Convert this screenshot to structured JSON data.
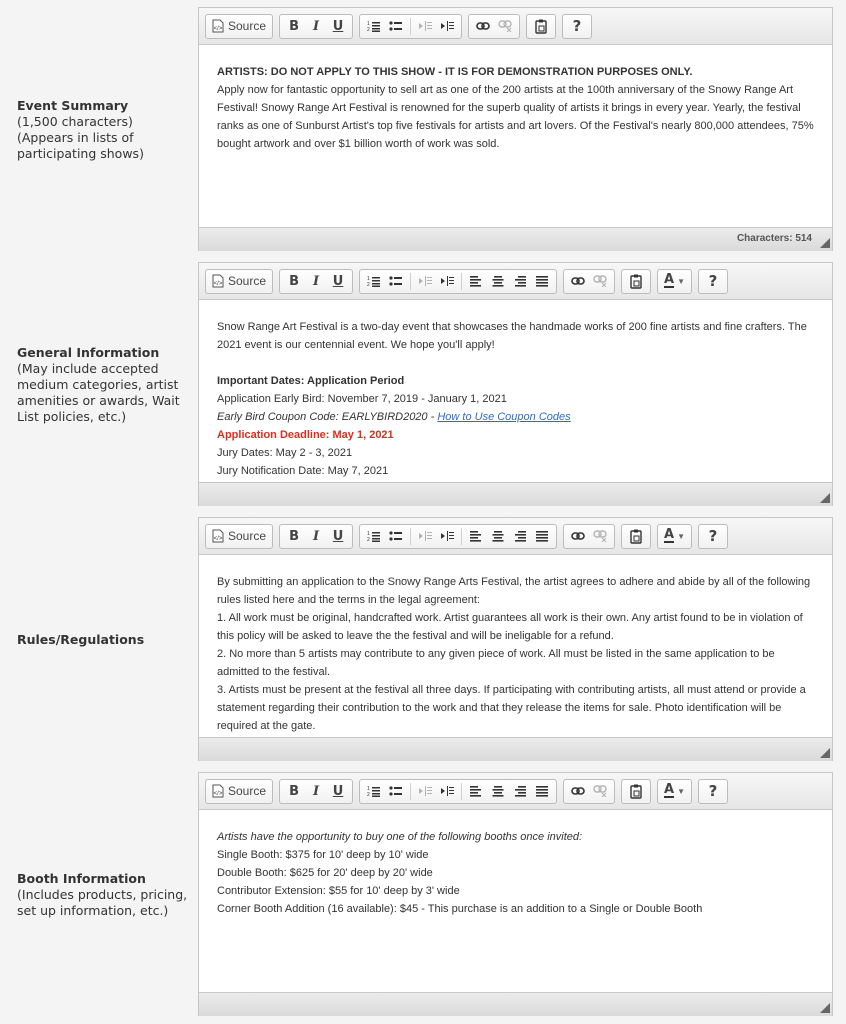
{
  "toolbar": {
    "source_label": "Source",
    "bold_label": "B",
    "italic_label": "I",
    "underline_label": "U",
    "help_label": "?",
    "text_color_label": "A"
  },
  "sections": [
    {
      "label_title": "Event Summary",
      "label_lines": [
        "(1,500 characters)",
        "(Appears in lists of participating shows)"
      ],
      "char_count": "Characters: 514",
      "content": [
        {
          "text": "ARTISTS: DO NOT APPLY TO THIS SHOW - IT IS FOR DEMONSTRATION PURPOSES ONLY.",
          "style": "bold"
        },
        {
          "text": "Apply now for fantastic opportunity to sell art as one of the 200 artists at the 100th anniversary of the Snowy Range Art Festival! Snowy Range Art Festival is renowned for the superb quality of artists it brings in every year. Yearly, the festival ranks as one of Sunburst Artist's top five festivals for artists and art lovers. Of the Festival's nearly 800,000 attendees, 75% bought artwork and over $1 billion worth of work was sold.",
          "style": "normal"
        }
      ]
    },
    {
      "label_title": "General Information",
      "label_lines": [
        "(May include accepted medium categories, artist amenities or awards, Wait List policies, etc.)"
      ],
      "content": [
        {
          "text": "Snow Range Art Festival is a two-day event that showcases the handmade works of 200 fine artists and fine crafters. The 2021 event is our centennial event. We hope you'll apply!",
          "style": "normal"
        },
        {
          "text": "",
          "style": "blank"
        },
        {
          "text": "Important Dates: Application Period",
          "style": "bold"
        },
        {
          "text": "Application Early Bird: November 7, 2019 - January 1, 2021",
          "style": "normal"
        },
        {
          "text": "Early Bird Coupon Code: EARLYBIRD2020 - ",
          "style": "italic",
          "link": "How to Use Coupon Codes"
        },
        {
          "text": "Application Deadline: May 1, 2021",
          "style": "red"
        },
        {
          "text": "Jury Dates: May 2 - 3, 2021",
          "style": "normal"
        },
        {
          "text": "Jury Notification Date: May 7, 2021",
          "style": "normal"
        }
      ]
    },
    {
      "label_title": "Rules/Regulations",
      "label_lines": [],
      "content": [
        {
          "text": "By submitting an application to the Snowy Range Arts Festival, the artist agrees to adhere and abide by all of the following rules listed here and the terms in the legal agreement:",
          "style": "normal"
        },
        {
          "text": "1. All work must be original, handcrafted work. Artist guarantees all work is their own. Any artist found to be in violation of this policy will be asked to leave the the festival and will be ineligable for a refund.",
          "style": "normal"
        },
        {
          "text": "2. No more than 5 artists may contribute to any given piece of work. All must be listed in the same application to be admitted to the festival.",
          "style": "normal"
        },
        {
          "text": "3. Artists must be present at the festival all three days. If participating with contributing artists, all must attend or provide a statement regarding their contribution to the work and that they release the items for sale. Photo identification will be required at the gate.",
          "style": "normal"
        }
      ]
    },
    {
      "label_title": "Booth Information",
      "label_lines": [
        "(Includes products, pricing, set up information, etc.)"
      ],
      "content": [
        {
          "text": "Artists have the opportunity to buy one of the following booths once invited:",
          "style": "italic"
        },
        {
          "text": "Single Booth: $375 for 10' deep by 10' wide",
          "style": "normal"
        },
        {
          "text": "Double Booth: $625 for 20' deep by 20' wide",
          "style": "normal"
        },
        {
          "text": "Contributor Extension: $55 for 10' deep by 3' wide",
          "style": "normal"
        },
        {
          "text": "Corner Booth Addition (16 available): $45 - This purchase is an addition to a Single or Double Booth",
          "style": "normal"
        }
      ]
    }
  ]
}
